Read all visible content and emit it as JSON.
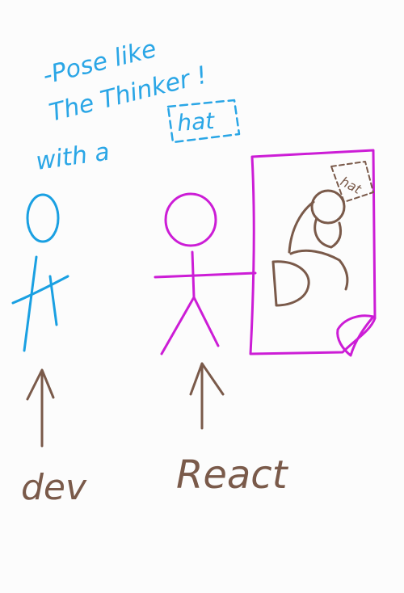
{
  "note": {
    "line1": "-Pose like",
    "line2": "The Thinker !",
    "line3_prefix": "with a",
    "hat_word": "hat"
  },
  "poster": {
    "hat_label": "hat"
  },
  "labels": {
    "dev": "dev",
    "react": "React"
  },
  "colors": {
    "note_blue": "#2aa6e6",
    "dev_blue": "#1aa0e2",
    "react_magenta": "#cc1dd6",
    "brown": "#7a5a4a",
    "background": "#fcfcfc"
  }
}
